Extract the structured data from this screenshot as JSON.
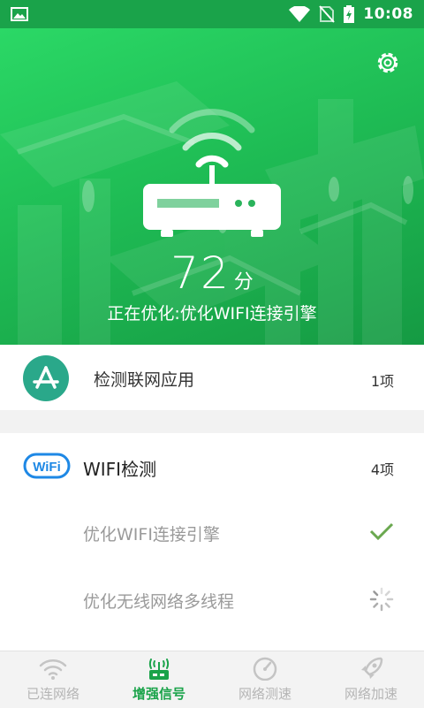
{
  "statusbar": {
    "time": "10:08"
  },
  "hero": {
    "score_value": "72",
    "score_unit": "分",
    "status_text": "正在优化:优化WIFI连接引擎"
  },
  "app_check": {
    "title": "检测联网应用",
    "count": "1项"
  },
  "wifi_check": {
    "badge_text": "WiFi",
    "title": "WIFI检测",
    "count": "4项",
    "items": [
      {
        "label": "优化WIFI连接引擎",
        "state": "done"
      },
      {
        "label": "优化无线网络多线程",
        "state": "loading"
      }
    ]
  },
  "tabs": [
    {
      "label": "已连网络",
      "icon": "wifi-icon",
      "active": false
    },
    {
      "label": "增强信号",
      "icon": "router-signal-icon",
      "active": true
    },
    {
      "label": "网络测速",
      "icon": "speedometer-icon",
      "active": false
    },
    {
      "label": "网络加速",
      "icon": "rocket-icon",
      "active": false
    }
  ],
  "colors": {
    "brand": "#1aa34a",
    "hero_light": "#2bd866",
    "app_icon": "#2aa88a",
    "check": "#6aa84f"
  }
}
